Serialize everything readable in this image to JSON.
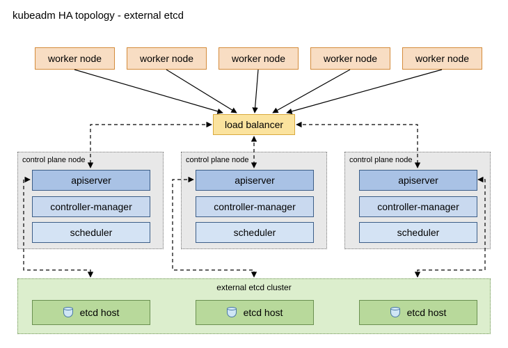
{
  "title": "kubeadm HA topology - external etcd",
  "workers": {
    "label": "worker node",
    "count": 5
  },
  "load_balancer": {
    "label": "load balancer"
  },
  "control_plane": {
    "group_label": "control plane node",
    "components": {
      "apiserver": "apiserver",
      "controller_manager": "controller-manager",
      "scheduler": "scheduler"
    },
    "count": 3
  },
  "etcd": {
    "cluster_label": "external etcd cluster",
    "host_label": "etcd host",
    "count": 3
  },
  "colors": {
    "worker_fill": "#f8ddc3",
    "worker_border": "#d48b3a",
    "lb_fill": "#fbe39e",
    "lb_border": "#d9a93d",
    "cp_group_fill": "#e8e8e8",
    "cp_api_fill": "#a9c2e5",
    "cp_cm_fill": "#c9d9ef",
    "cp_sch_fill": "#d4e3f4",
    "cp_border": "#3b5d87",
    "etcd_group_fill": "#dceecd",
    "etcd_host_fill": "#b8d99b",
    "etcd_border": "#6a9050"
  }
}
